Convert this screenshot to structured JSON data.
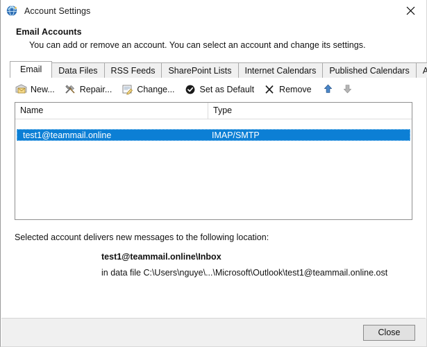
{
  "window": {
    "title": "Account Settings",
    "title_icon": "outlook-globe-icon",
    "close_icon": "close-icon"
  },
  "header": {
    "title": "Email Accounts",
    "subtitle": "You can add or remove an account. You can select an account and change its settings."
  },
  "tabs": [
    {
      "label": "Email",
      "active": true
    },
    {
      "label": "Data Files",
      "active": false
    },
    {
      "label": "RSS Feeds",
      "active": false
    },
    {
      "label": "SharePoint Lists",
      "active": false
    },
    {
      "label": "Internet Calendars",
      "active": false
    },
    {
      "label": "Published Calendars",
      "active": false
    },
    {
      "label": "Address Books",
      "active": false
    }
  ],
  "toolbar": {
    "new_label": "New...",
    "repair_label": "Repair...",
    "change_label": "Change...",
    "set_default_label": "Set as Default",
    "remove_label": "Remove",
    "move_up_icon": "arrow-up-icon",
    "move_down_icon": "arrow-down-icon"
  },
  "account_list": {
    "columns": [
      "Name",
      "Type"
    ],
    "rows": [
      {
        "name": "test1@teammail.online",
        "type": "IMAP/SMTP",
        "selected": true
      }
    ]
  },
  "delivery": {
    "lead": "Selected account delivers new messages to the following location:",
    "target": "test1@teammail.online\\Inbox",
    "path": "in data file C:\\Users\\nguye\\...\\Microsoft\\Outlook\\test1@teammail.online.ost"
  },
  "footer": {
    "close_label": "Close"
  },
  "colors": {
    "selection_blue": "#0c7fd5",
    "tab_inactive": "#f0f0f0",
    "footer_bg": "#f0f0f0",
    "arrow_enabled": "#3a74b8",
    "arrow_disabled": "#a0a0a0"
  }
}
